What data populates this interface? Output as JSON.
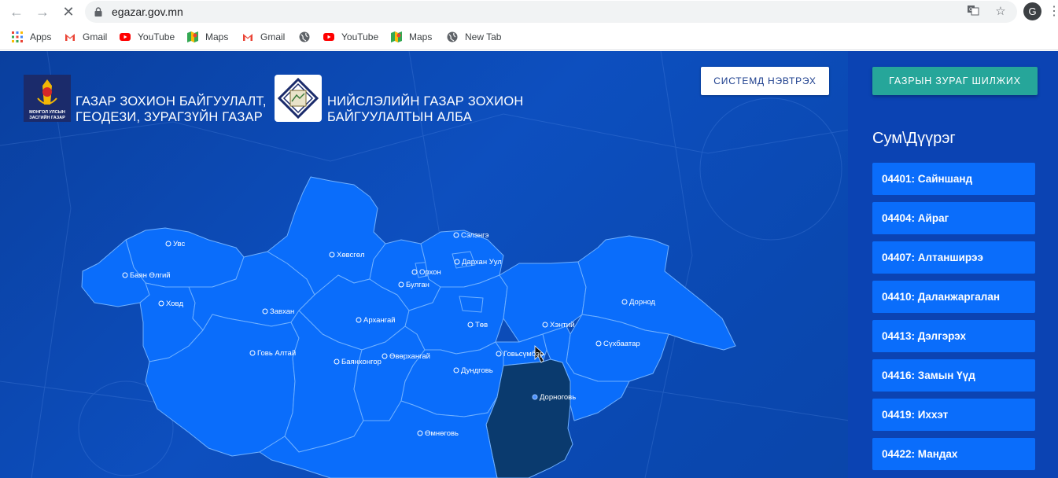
{
  "browser": {
    "url": "egazar.gov.mn",
    "avatar_letter": "G",
    "bookmarks": [
      {
        "label": "Apps",
        "icon": "apps-grid-icon"
      },
      {
        "label": "Gmail",
        "icon": "gmail-icon"
      },
      {
        "label": "YouTube",
        "icon": "youtube-icon"
      },
      {
        "label": "Maps",
        "icon": "maps-icon"
      },
      {
        "label": "Gmail",
        "icon": "gmail-icon"
      },
      {
        "label": "",
        "icon": "globe-icon"
      },
      {
        "label": "YouTube",
        "icon": "youtube-icon"
      },
      {
        "label": "Maps",
        "icon": "maps-icon"
      },
      {
        "label": "New Tab",
        "icon": "globe-icon"
      }
    ]
  },
  "header": {
    "agency_line1": "ГАЗАР ЗОХИОН БАЙГУУЛАЛТ,",
    "agency_line2": "ГЕОДЕЗИ, ЗУРАГЗҮЙН ГАЗАР",
    "city_line1": "НИЙСЛЭЛИЙН ГАЗАР ЗОХИОН",
    "city_line2": "БАЙГУУЛАЛТЫН АЛБА",
    "emblem_caption": "МОНГОЛ УЛСЫН ЗАСГИЙН ГАЗАР",
    "login_label": "СИСТЕМД НЭВТРЭХ",
    "switch_map_label": "ГАЗРЫН ЗУРАГ ШИЛЖИХ"
  },
  "sidebar": {
    "title": "Сум\\Дүүрэг",
    "districts": [
      "04401: Сайншанд",
      "04404: Айраг",
      "04407: Алтанширээ",
      "04410: Даланжаргалан",
      "04413: Дэлгэрэх",
      "04416: Замын Үүд",
      "04419: Иххэт",
      "04422: Мандах"
    ]
  },
  "map": {
    "selected_province": "Дорноговь",
    "colors": {
      "province": "#0a6dfb",
      "selected": "#0a3a6e",
      "border": "#5aa0ff"
    },
    "provinces": [
      "Увс",
      "Баян Өлгий",
      "Ховд",
      "Завхан",
      "Говь Алтай",
      "Хөвсгөл",
      "Архангай",
      "Баянхонгор",
      "Өвөрхангай",
      "Булган",
      "Орхон",
      "Сэлэнгэ",
      "Дархан Уул",
      "Төв",
      "Хэнтий",
      "Дорнод",
      "Сүхбаатар",
      "Говьсүмбэр",
      "Дундговь",
      "Өмнөговь",
      "Дорноговь"
    ]
  }
}
